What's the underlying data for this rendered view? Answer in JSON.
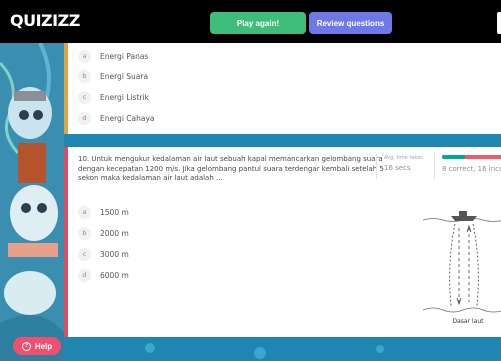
{
  "header": {
    "logo": "QUIZIZZ",
    "play_again_label": "Play again!",
    "review_questions_label": "Review questions"
  },
  "prev_question": {
    "options": [
      {
        "letter": "a",
        "text": "Energi Panas"
      },
      {
        "letter": "b",
        "text": "Energi Suara"
      },
      {
        "letter": "c",
        "text": "Energi Listrik"
      },
      {
        "letter": "d",
        "text": "Energi Cahaya"
      }
    ]
  },
  "question": {
    "text": "10. Untuk mengukur kedalaman air laut sebuah kapal memancarkan gelombang suara dengan kecepatan 1200 m/s. Jika gelombang pantul suara terdengar kembali setelah 5 sekon maka kedalaman air laut adalah ...",
    "avg_time_label": "Avg. time taken",
    "avg_time_value": "16 secs",
    "correct_fraction": 0.33,
    "result_text": "8 correct, 16 incorr",
    "options": [
      {
        "letter": "a",
        "text": "1500 m"
      },
      {
        "letter": "b",
        "text": "2000 m"
      },
      {
        "letter": "c",
        "text": "3000 m"
      },
      {
        "letter": "d",
        "text": "6000 m"
      }
    ],
    "diagram_caption": "Dasar laut"
  },
  "help": {
    "label": "Help",
    "icon_glyph": "?"
  },
  "colors": {
    "topbar": "#000000",
    "play_again": "#3fbe7a",
    "review_questions": "#6e78e6",
    "help": "#f0506e",
    "correct": "#00a89b",
    "incorrect": "#ef5b6b"
  }
}
